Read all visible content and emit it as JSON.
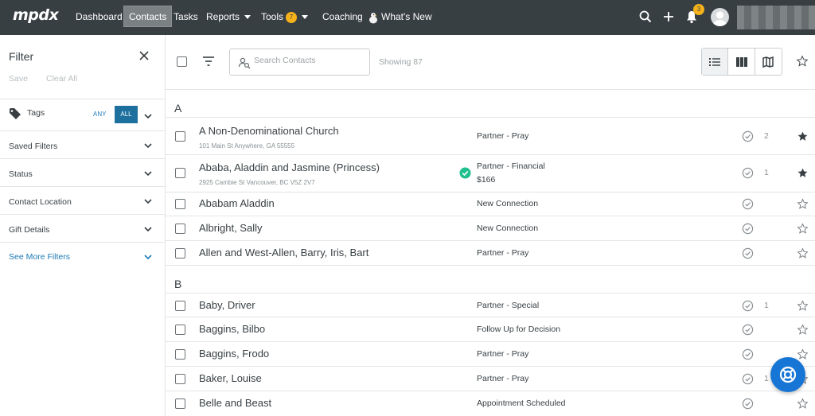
{
  "nav": {
    "logo": "mpdx",
    "items": {
      "dashboard": "Dashboard",
      "contacts": "Contacts",
      "tasks": "Tasks",
      "reports": "Reports",
      "tools": "Tools",
      "tools_badge": "7",
      "coaching": "Coaching",
      "whats_new": "What's New"
    },
    "notifications_badge": "3"
  },
  "sidebar": {
    "title": "Filter",
    "save": "Save",
    "clear_all": "Clear All",
    "tags": {
      "label": "Tags",
      "any": "ANY",
      "all": "ALL"
    },
    "filters": {
      "saved": "Saved Filters",
      "status": "Status",
      "location": "Contact Location",
      "gift": "Gift Details",
      "more": "See More Filters"
    }
  },
  "toolbar": {
    "search_placeholder": "Search Contacts",
    "showing": "Showing 87"
  },
  "sections": {
    "a": {
      "letter": "A",
      "rows": [
        {
          "name": "A Non-Denominational Church",
          "address": "101 Main St Anywhere, GA 55555",
          "status": "Partner - Pray",
          "tasks": "2",
          "starred": true
        },
        {
          "name": "Ababa, Aladdin and Jasmine (Princess)",
          "address": "2925 Cambie St Vancouver, BC V5Z 2V7",
          "status": "Partner - Financial",
          "amount": "$166",
          "tasks": "1",
          "starred": true,
          "verified": true
        },
        {
          "name": "Ababam Aladdin",
          "status": "New Connection",
          "starred": false
        },
        {
          "name": "Albright, Sally",
          "status": "New Connection",
          "starred": false
        },
        {
          "name": "Allen and West-Allen, Barry, Iris, Bart",
          "status": "Partner - Pray",
          "starred": false
        }
      ]
    },
    "b": {
      "letter": "B",
      "rows": [
        {
          "name": "Baby, Driver",
          "status": "Partner - Special",
          "tasks": "1",
          "starred": false
        },
        {
          "name": "Baggins, Bilbo",
          "status": "Follow Up for Decision",
          "starred": false
        },
        {
          "name": "Baggins, Frodo",
          "status": "Partner - Pray",
          "starred": false
        },
        {
          "name": "Baker, Louise",
          "status": "Partner - Pray",
          "tasks": "1",
          "starred": false
        },
        {
          "name": "Belle and Beast",
          "status": "Appointment Scheduled",
          "starred": false
        }
      ]
    }
  },
  "colors": {
    "nav_bg": "#383f43",
    "accent_blue": "#1d7bb6",
    "badge_yellow": "#f6b21b",
    "verified_green": "#1fbf8f",
    "help_blue": "#1776d5"
  }
}
